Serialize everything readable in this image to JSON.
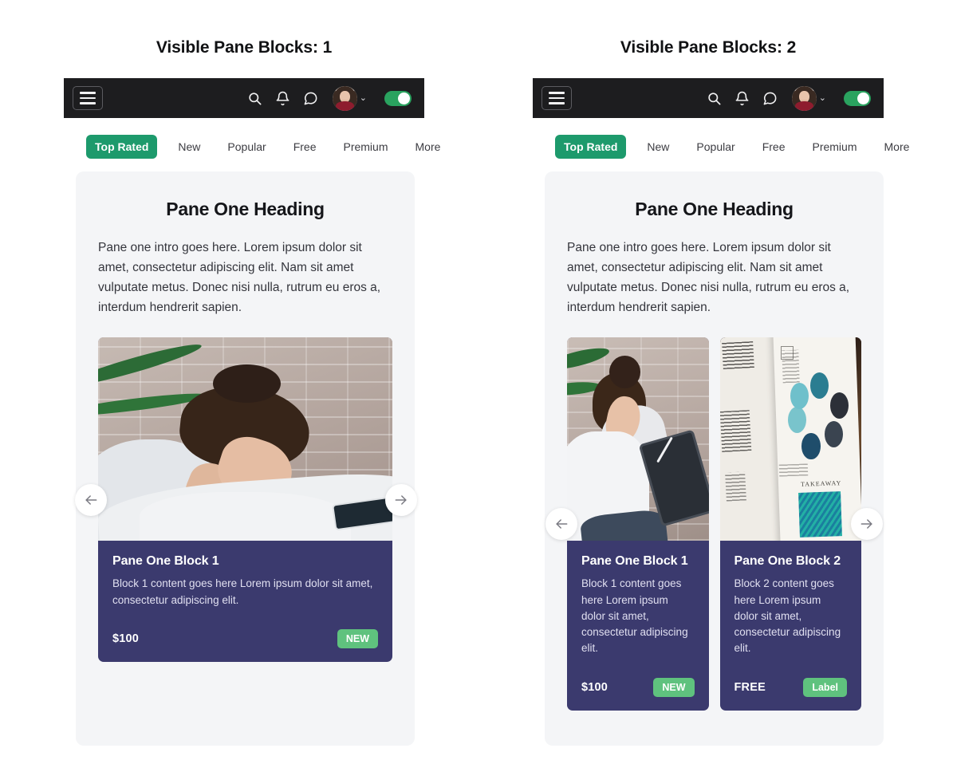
{
  "panes": [
    {
      "title": "Visible Pane Blocks: 1",
      "navbar": {
        "menu_icon": "hamburger-menu-icon",
        "icons": [
          "search-icon",
          "bell-icon",
          "chat-bubble-icon"
        ],
        "avatar": "user-avatar",
        "caret": "⌄",
        "toggle_state": "on"
      },
      "tabs": [
        {
          "label": "Top Rated",
          "active": true
        },
        {
          "label": "New",
          "active": false
        },
        {
          "label": "Popular",
          "active": false
        },
        {
          "label": "Free",
          "active": false
        },
        {
          "label": "Premium",
          "active": false
        },
        {
          "label": "More",
          "active": false
        }
      ],
      "heading": "Pane One Heading",
      "intro": "Pane one intro goes here. Lorem ipsum dolor sit amet, consectetur adipiscing elit. Nam sit amet vulputate metus. Donec nisi nulla, rutrum eu eros a, interdum hendrerit sapien.",
      "arrows": {
        "prev": "arrow-left-icon",
        "next": "arrow-right-icon"
      },
      "cards": [
        {
          "title": "Pane One Block 1",
          "text": "Block 1 content goes here Lorem ipsum dolor sit amet, consectetur adipiscing elit.",
          "price": "$100",
          "badge": "NEW",
          "image": "woman-reading-on-bed-brick-wall"
        }
      ]
    },
    {
      "title": "Visible Pane Blocks: 2",
      "navbar": {
        "menu_icon": "hamburger-menu-icon",
        "icons": [
          "search-icon",
          "bell-icon",
          "chat-bubble-icon"
        ],
        "avatar": "user-avatar",
        "caret": "⌄",
        "toggle_state": "on"
      },
      "tabs": [
        {
          "label": "Top Rated",
          "active": true
        },
        {
          "label": "New",
          "active": false
        },
        {
          "label": "Popular",
          "active": false
        },
        {
          "label": "Free",
          "active": false
        },
        {
          "label": "Premium",
          "active": false
        },
        {
          "label": "More",
          "active": false
        }
      ],
      "heading": "Pane One Heading",
      "intro": "Pane one intro goes here. Lorem ipsum dolor sit amet, consectetur adipiscing elit. Nam sit amet vulputate metus. Donec nisi nulla, rutrum eu eros a, interdum hendrerit sapien.",
      "arrows": {
        "prev": "arrow-left-icon",
        "next": "arrow-right-icon"
      },
      "cards": [
        {
          "title": "Pane One Block 1",
          "text": "Block 1 content goes here Lorem ipsum dolor sit amet, consectetur adipiscing elit.",
          "price": "$100",
          "badge": "NEW",
          "image": "woman-with-tablet-brick-wall"
        },
        {
          "title": "Pane One Block 2",
          "text": "Block 2 content goes here Lorem ipsum dolor sit amet, consectetur adipiscing elit.",
          "price": "FREE",
          "badge": "Label",
          "image": "open-book-with-circular-diagram"
        }
      ]
    }
  ],
  "colors": {
    "navbar_background": "#1d1d1f",
    "tab_active_background": "#1d9a6c",
    "card_background": "#3b3a6e",
    "badge_background": "#5fc27e",
    "pane_background": "#f4f5f7",
    "toggle_on": "#2aa35f",
    "page_background": "#ffffff"
  },
  "book_label": "TAKEAWAY"
}
